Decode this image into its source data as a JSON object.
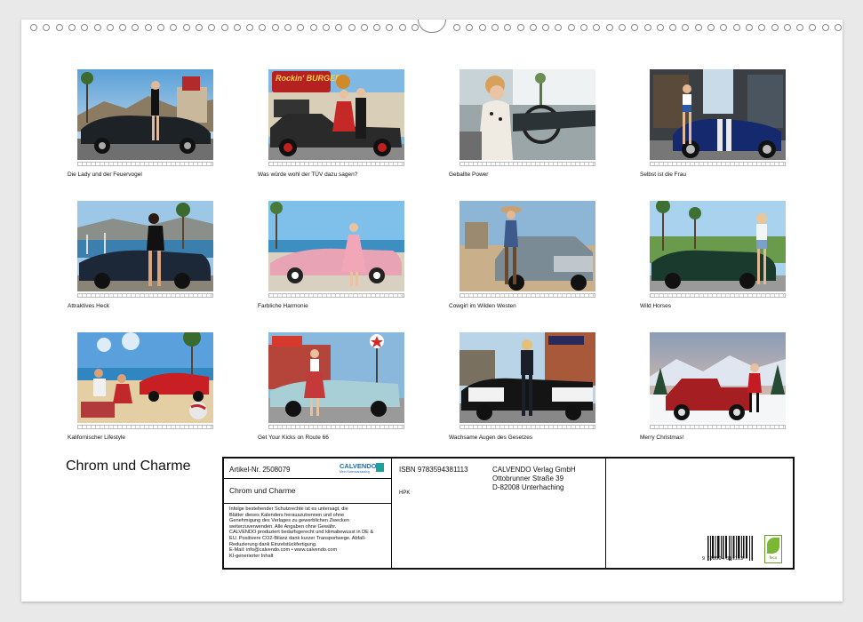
{
  "calendar": {
    "title": "Chrom und Charme",
    "thumbnails": [
      {
        "caption": "Die Lady und der Feuervogel"
      },
      {
        "caption": "Was würde wohl der TÜV dazu sagen?",
        "sign": "Rockin' BURGER"
      },
      {
        "caption": "Geballte Power"
      },
      {
        "caption": "Selbst ist die Frau"
      },
      {
        "caption": "Attraktives Heck"
      },
      {
        "caption": "Farbliche Harmonie"
      },
      {
        "caption": "Cowgirl im Wilden Westen"
      },
      {
        "caption": "Wild Horses"
      },
      {
        "caption": "Kalifornischer Lifestyle"
      },
      {
        "caption": "Get Your Kicks on Route 66"
      },
      {
        "caption": "Wachsame Augen des Gesetzes"
      },
      {
        "caption": "Merry Christmas!"
      }
    ]
  },
  "infobox": {
    "article": "Artikel-Nr. 2508079",
    "brand": "CALVENDO",
    "brand_tagline": "Mein Kalendarkatalog",
    "title": "Chrom und Charme",
    "legal_lines": [
      "Infolge bestehender Schutzrechte ist es untersagt, die",
      "Blätter dieses Kalenders herauszutrennen und ohne",
      "Genehmigung des Verlages zu gewerblichen Zwecken",
      "weiterzuverwenden. Alle Angaben ohne Gewähr.",
      "CALVENDO produziert bedarfsgerecht und klimabewusst in DE &",
      "EU. Positivere CO2-Bilanz dank kurzer Transportwege. Abfall-",
      "Reduzierung dank Einzelstückfertigung.",
      "E-Mail: info@calvendo.com • www.calvendo.com",
      "KI-generierter Inhalt"
    ],
    "isbn": "ISBN 9783594381113",
    "hpk": "HPK",
    "publisher_lines": [
      "CALVENDO Verlag GmbH",
      "Ottobrunner Straße 39",
      "D-82008 Unterhaching"
    ],
    "barcode_text": "9 783594 381113",
    "eco_label": "feco"
  }
}
